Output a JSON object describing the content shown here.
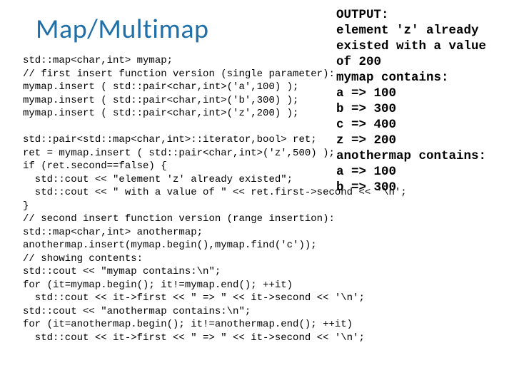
{
  "title": "Map/Multimap",
  "code": "std::map<char,int> mymap;\n// first insert function version (single parameter):\nmymap.insert ( std::pair<char,int>('a',100) );\nmymap.insert ( std::pair<char,int>('b',300) );\nmymap.insert ( std::pair<char,int>('z',200) );\n\nstd::pair<std::map<char,int>::iterator,bool> ret;\nret = mymap.insert ( std::pair<char,int>('z',500) );\nif (ret.second==false) {\n  std::cout << \"element 'z' already existed\";\n  std::cout << \" with a value of \" << ret.first->second << '\\n';\n}\n// second insert function version (range insertion):\nstd::map<char,int> anothermap;\nanothermap.insert(mymap.begin(),mymap.find('c'));\n// showing contents:\nstd::cout << \"mymap contains:\\n\";\nfor (it=mymap.begin(); it!=mymap.end(); ++it)\n  std::cout << it->first << \" => \" << it->second << '\\n';\nstd::cout << \"anothermap contains:\\n\";\nfor (it=anothermap.begin(); it!=anothermap.end(); ++it)\n  std::cout << it->first << \" => \" << it->second << '\\n';",
  "output": "OUTPUT:\nelement 'z' already existed with a value of 200\nmymap contains:\na => 100\nb => 300\nc => 400\nz => 200\nanothermap contains:\na => 100\nb => 300"
}
